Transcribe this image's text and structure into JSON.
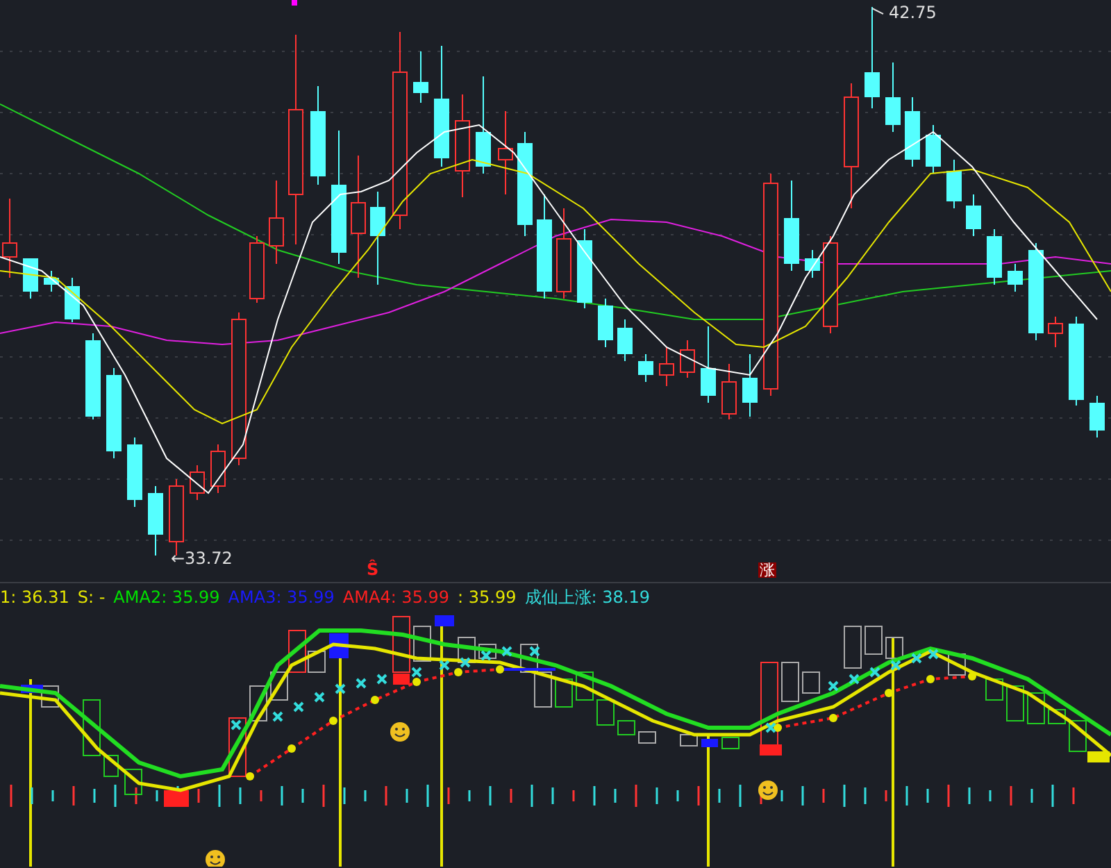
{
  "price_chart": {
    "high_label": "42.75",
    "low_label": "←33.72",
    "signals": [
      {
        "kind": "s_marker",
        "text": "Ŝ"
      },
      {
        "kind": "rise_tag",
        "text": "涨"
      }
    ]
  },
  "indicator": {
    "legend": [
      {
        "text": "1: 36.31",
        "color": "#e6e600"
      },
      {
        "text": "S: -",
        "color": "#e6e600"
      },
      {
        "text": "AMA2: 35.99",
        "color": "#00e000"
      },
      {
        "text": "AMA3: 35.99",
        "color": "#1a1aff"
      },
      {
        "text": "AMA4: 35.99",
        "color": "#ff2020"
      },
      {
        "text": ": 35.99",
        "color": "#e6e600"
      },
      {
        "text": "成仙上涨: 38.19",
        "color": "#33dddd"
      }
    ]
  }
}
